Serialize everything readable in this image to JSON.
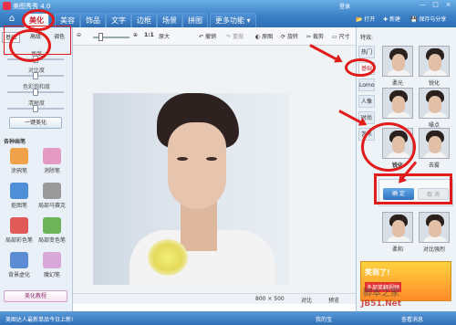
{
  "titlebar": {
    "app_title": "美图秀秀 4.0",
    "login": "登录",
    "minimize": "—",
    "maximize": "□",
    "close": "×"
  },
  "tabs": [
    "美化",
    "美容",
    "饰品",
    "文字",
    "边框",
    "场景",
    "拼图",
    "更多功能 ▾"
  ],
  "active_tab": "美化",
  "top_actions": {
    "new": "新建",
    "open": "打开",
    "save_share": "保存与分享"
  },
  "left": {
    "subtabs": [
      "基础",
      "高级",
      "调色"
    ],
    "sliders": [
      {
        "label": "亮度",
        "value": 0.5
      },
      {
        "label": "对比度",
        "value": 0.5
      },
      {
        "label": "色彩饱和度",
        "value": 0.5
      },
      {
        "label": "清晰度",
        "value": 0.5
      }
    ],
    "auto_beautify": "一键美化",
    "brush_section": "各种画笔",
    "tools": [
      {
        "label": "涂鸦笔",
        "icon": "pencil-icon",
        "color": "#f0a24a"
      },
      {
        "label": "消除笔",
        "icon": "eraser-icon",
        "color": "#e39bc4"
      },
      {
        "label": "抠图笔",
        "icon": "cutout-pen-icon",
        "color": "#4f8fd8"
      },
      {
        "label": "局部马赛克",
        "icon": "mosaic-icon",
        "color": "#9a9a9a"
      },
      {
        "label": "局部彩色笔",
        "icon": "color-brush-icon",
        "color": "#e05a5a"
      },
      {
        "label": "局部变色笔",
        "icon": "recolor-brush-icon",
        "color": "#6cb35a"
      },
      {
        "label": "背景虚化",
        "icon": "blur-background-icon",
        "color": "#5b8bd2"
      },
      {
        "label": "魔幻笔",
        "icon": "magic-pen-icon",
        "color": "#d8a9d8"
      }
    ],
    "beauty_tutorial": "美化教程"
  },
  "toolbar": {
    "zoom_value": 0.3,
    "ratio": "1:1",
    "original_size": "原大",
    "rotate": "旋转",
    "crop": "裁剪",
    "resize": "尺寸",
    "undo": "撤销",
    "redo": "重做",
    "original": "原图"
  },
  "canvas": {
    "size": "800 × 500",
    "compare": "对比",
    "preview": "预览"
  },
  "right": {
    "title": "特效:",
    "categories": [
      "热门",
      "基础",
      "Lomo",
      "人像",
      "时尚",
      "艺术"
    ],
    "active_category": "基础",
    "thumbs": [
      "柔光",
      "锐化",
      "",
      "噪点",
      "锐化",
      "去雾",
      "柔和",
      "对比强烈"
    ],
    "confirm": "确 定",
    "cancel": "取 消",
    "ad_title": "笑到了!",
    "ad_sub": "多部笑翻视频"
  },
  "statusbar": {
    "message": "美图达人最新单品今日上新!",
    "share": "我的宝",
    "tip": "查看消息"
  },
  "watermark": {
    "line1": "脚本之家",
    "line2": "JB51.Net"
  }
}
